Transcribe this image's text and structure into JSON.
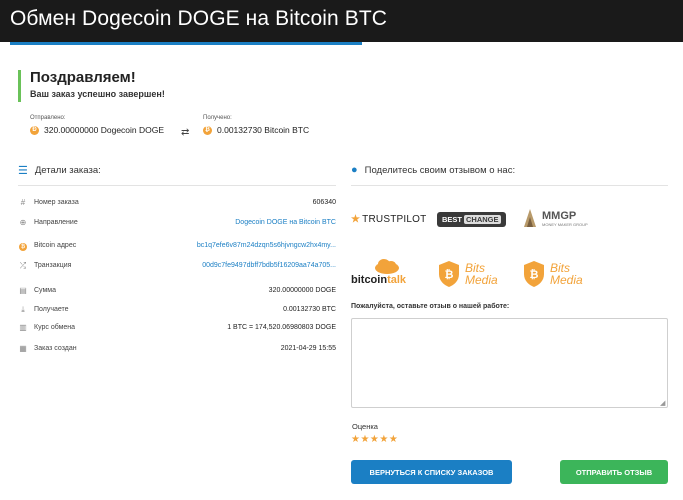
{
  "header": {
    "title": "Обмен Dogecoin DOGE на Bitcoin BTC"
  },
  "status": {
    "title": "Поздравляем!",
    "subtitle": "Ваш заказ успешно завершен!"
  },
  "transfer": {
    "sent_label": "Отправлено:",
    "sent_value": "320.00000000 Dogecoin DOGE",
    "received_label": "Получено:",
    "received_value": "0.00132730 Bitcoin BTC"
  },
  "details": {
    "title": "Детали заказа:",
    "rows": [
      {
        "key": "Номер заказа",
        "value": "606340"
      },
      {
        "key": "Направление",
        "value": "Dogecoin DOGE на Bitcoin BTC"
      },
      {
        "key": "Bitcoin адрес",
        "value": "bc1q7efe6v87m24dzqn5s6hjvngcw2hx4my..."
      },
      {
        "key": "Транзакция",
        "value": "00d9c7fe9497dbff7bdb5f16209aa74a705..."
      },
      {
        "key": "Сумма",
        "value": "320.00000000 DOGE"
      },
      {
        "key": "Получаете",
        "value": "0.00132730 BTC"
      },
      {
        "key": "Курс обмена",
        "value": "1 BTC = 174,520.06980803 DOGE"
      },
      {
        "key": "Заказ создан",
        "value": "2021-04-29 15:55"
      }
    ]
  },
  "feedback": {
    "title": "Поделитесь своим отзывом о нас:",
    "sites": {
      "trustpilot": "TRUSTPILOT",
      "bestchange_a": "BEST",
      "bestchange_b": "CHANGE",
      "mmgp": "MMGP",
      "mmgp_sub": "MONEY MAKER GROUP",
      "bitcointalk_a": "bitcoin",
      "bitcointalk_b": "talk",
      "bits_line1": "Bits",
      "bits_line2": "Media"
    },
    "review_label": "Пожалуйста, оставьте отзыв о нашей работе:",
    "review_value": "",
    "rating_label": "Оценка",
    "stars": "★★★★★",
    "rating": 5
  },
  "buttons": {
    "back": "ВЕРНУТЬСЯ К СПИСКУ ЗАКАЗОВ",
    "send": "ОТПРАВИТЬ ОТЗЫВ"
  },
  "colors": {
    "accent": "#1b7fc4",
    "success": "#3cb55a",
    "coin": "#f2a33a",
    "header": "#1a1a1a"
  }
}
